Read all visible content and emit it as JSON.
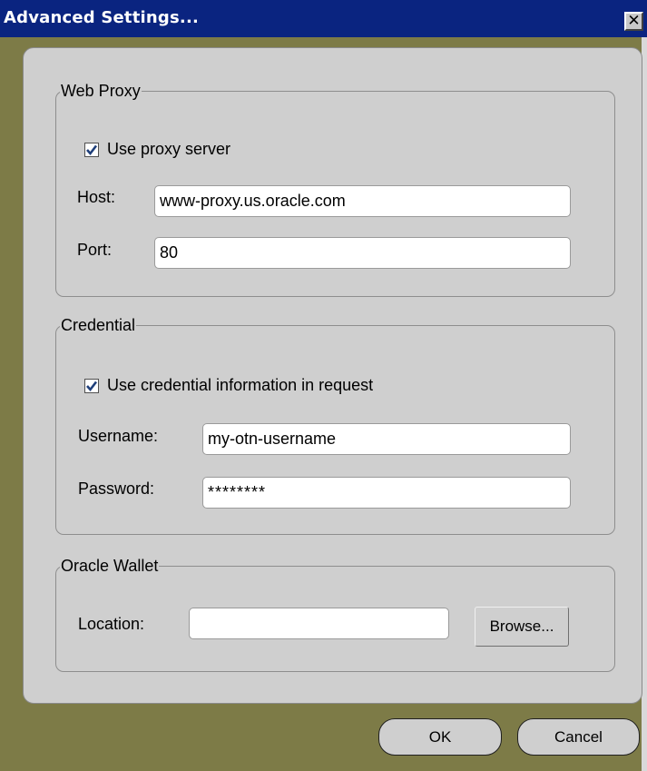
{
  "dialog": {
    "title": "Advanced Settings...",
    "close_glyph": "✕"
  },
  "web_proxy": {
    "legend": "Web Proxy",
    "use_proxy_label": "Use proxy server",
    "use_proxy_checked": true,
    "host_label": "Host:",
    "host_value": "www-proxy.us.oracle.com",
    "port_label": "Port:",
    "port_value": "80"
  },
  "credential": {
    "legend": "Credential",
    "use_credential_label": "Use credential information in request",
    "use_credential_checked": true,
    "username_label": "Username:",
    "username_value": "my-otn-username",
    "password_label": "Password:",
    "password_value": "********"
  },
  "oracle_wallet": {
    "legend": "Oracle Wallet",
    "location_label": "Location:",
    "location_value": "",
    "browse_label": "Browse..."
  },
  "footer": {
    "ok_label": "OK",
    "cancel_label": "Cancel"
  },
  "colors": {
    "titlebar": "#0a2480",
    "frame": "#7d7b47",
    "panel": "#cfcfcf",
    "checkmark": "#1f3f7a"
  }
}
